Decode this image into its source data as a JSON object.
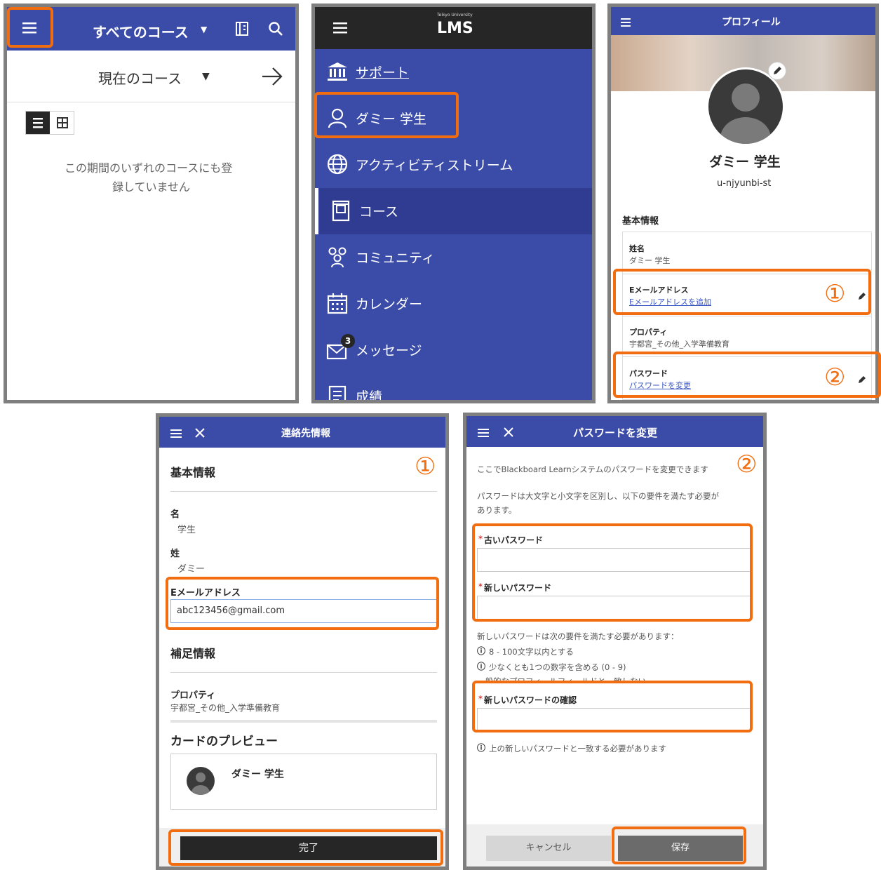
{
  "p1": {
    "title": "すべてのコース",
    "subtitle": "現在のコース",
    "empty_line1": "この期間のいずれのコースにも登",
    "empty_line2": "録していません"
  },
  "p2": {
    "logo_small": "Teikyo University",
    "logo": "LMS",
    "nav": [
      {
        "label": "サポート",
        "icon": "institution-icon"
      },
      {
        "label": "ダミー 学生",
        "icon": "person-icon"
      },
      {
        "label": "アクティビティストリーム",
        "icon": "globe-icon"
      },
      {
        "label": "コース",
        "icon": "course-icon"
      },
      {
        "label": "コミュニティ",
        "icon": "community-icon"
      },
      {
        "label": "カレンダー",
        "icon": "calendar-icon"
      },
      {
        "label": "メッセージ",
        "icon": "message-icon",
        "badge": "3"
      },
      {
        "label": "成績",
        "icon": "grades-icon"
      }
    ]
  },
  "p3": {
    "title": "プロフィール",
    "name": "ダミー 学生",
    "username": "u-njyunbi-st",
    "section": "基本情報",
    "fields": [
      {
        "label": "姓名",
        "value": "ダミー 学生"
      },
      {
        "label": "Eメールアドレス",
        "value": "Eメールアドレスを追加"
      },
      {
        "label": "プロパティ",
        "value": "宇都宮_その他_入学準備教育"
      },
      {
        "label": "パスワード",
        "value": "パスワードを変更"
      }
    ],
    "marker1": "①",
    "marker2": "②"
  },
  "p4": {
    "title": "連絡先情報",
    "marker": "①",
    "section1": "基本情報",
    "first_label": "名",
    "first_value": "学生",
    "last_label": "姓",
    "last_value": "ダミー",
    "email_label": "Eメールアドレス",
    "email_value": "abc123456@gmail.com",
    "section2": "補足情報",
    "property_label": "プロパティ",
    "property_value": "宇都宮_その他_入学準備教育",
    "preview_title": "カードのプレビュー",
    "preview_name": "ダミー 学生",
    "done_button": "完了"
  },
  "p5": {
    "title": "パスワードを変更",
    "marker": "②",
    "intro": "ここでBlackboard Learnシステムのパスワードを変更できます",
    "note_line1": "パスワードは大文字と小文字を区別し、以下の要件を満たす必要が",
    "note_line2": "あります。",
    "old_label": "古いパスワード",
    "new_label": "新しいパスワード",
    "req_title": "新しいパスワードは次の要件を満たす必要があります：",
    "req1": "8 - 100文字以内とする",
    "req2": "少なくとも1つの数字を含める (0 - 9)",
    "req3": "一般的なプロフィールフィールドと一致しない",
    "confirm_label": "新しいパスワードの確認",
    "confirm_note": "上の新しいパスワードと一致する必要があります",
    "cancel_button": "キャンセル",
    "save_button": "保存"
  },
  "colors": {
    "header": "#3b4ba8",
    "nav_bg": "#3b4ba8",
    "highlight": "#f26d0f"
  }
}
